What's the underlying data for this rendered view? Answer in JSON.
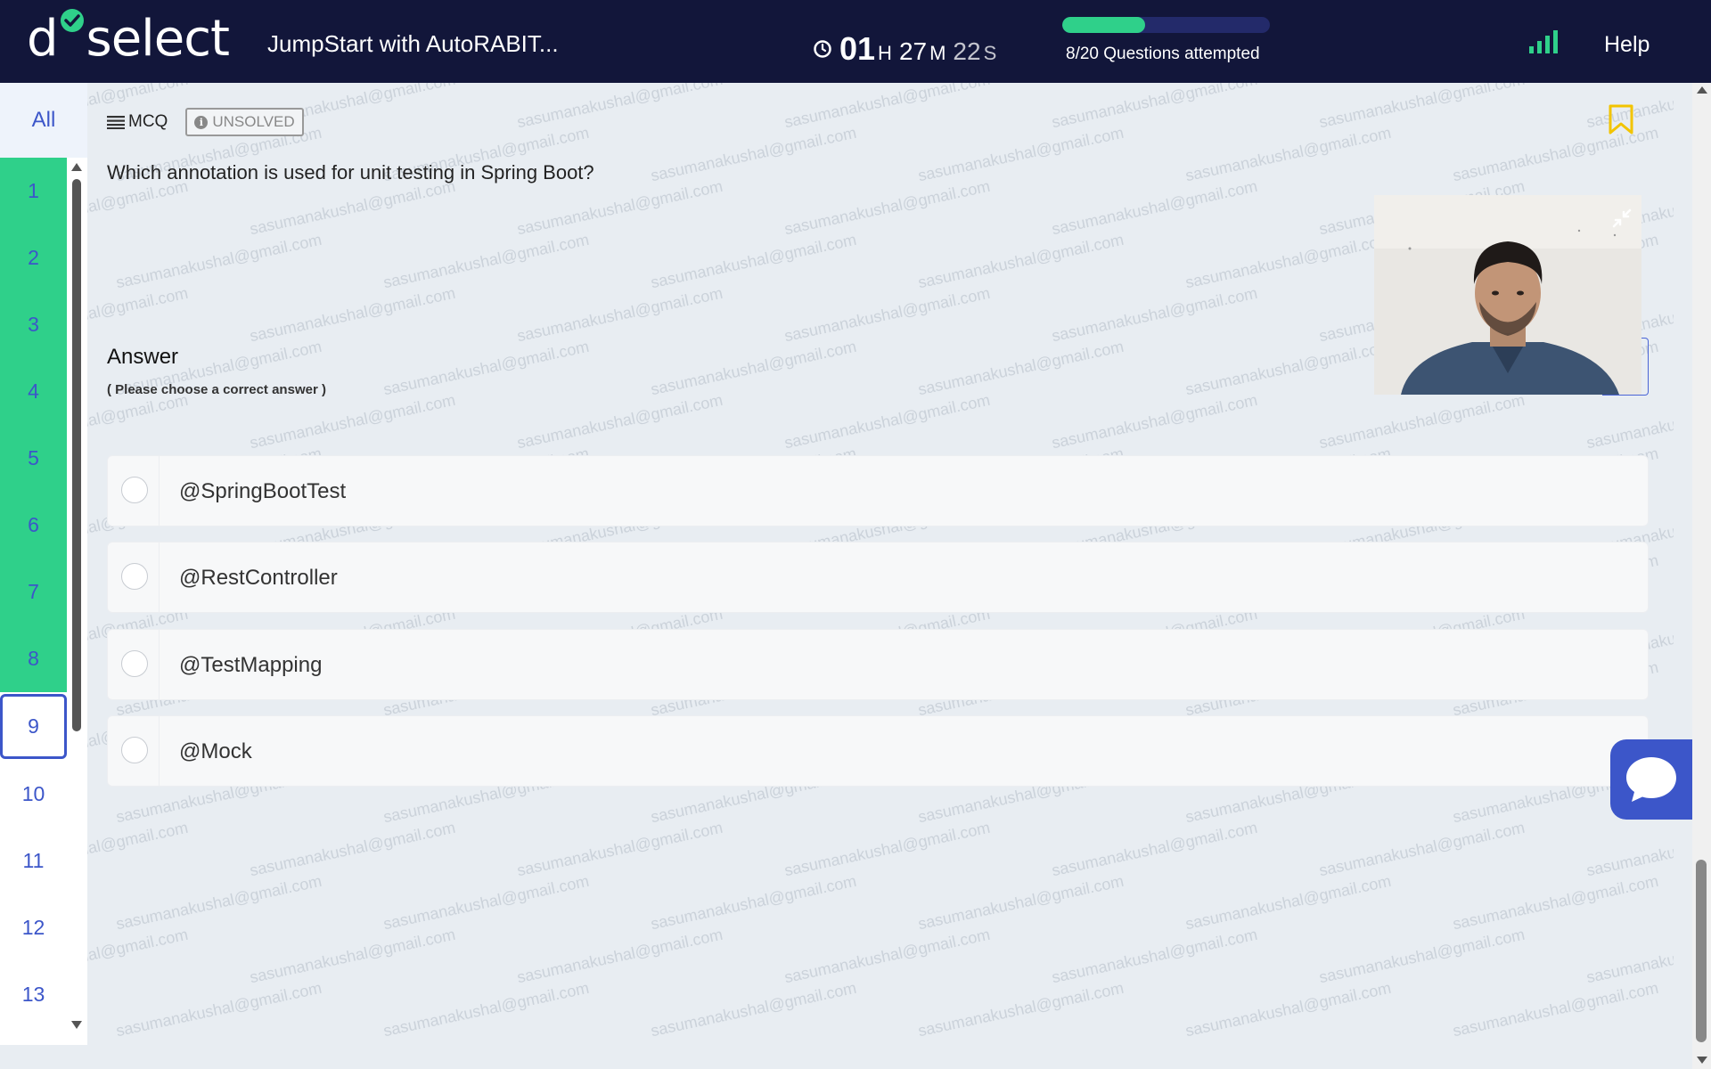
{
  "header": {
    "logo_left": "d",
    "logo_right": "select",
    "test_title": "JumpStart with AutoRABIT...",
    "timer": {
      "hours": "01",
      "hours_unit": "H",
      "minutes": "27",
      "minutes_unit": "M",
      "seconds": "22",
      "seconds_unit": "S"
    },
    "progress": {
      "attempted": 8,
      "total": 20,
      "text": "8/20 Questions attempted"
    },
    "help_label": "Help"
  },
  "sidebar": {
    "all_label": "All",
    "questions": [
      {
        "num": "1",
        "state": "answered"
      },
      {
        "num": "2",
        "state": "answered"
      },
      {
        "num": "3",
        "state": "answered"
      },
      {
        "num": "4",
        "state": "answered"
      },
      {
        "num": "5",
        "state": "answered"
      },
      {
        "num": "6",
        "state": "answered"
      },
      {
        "num": "7",
        "state": "answered"
      },
      {
        "num": "8",
        "state": "answered"
      },
      {
        "num": "9",
        "state": "current"
      },
      {
        "num": "10",
        "state": "unanswered"
      },
      {
        "num": "11",
        "state": "unanswered"
      },
      {
        "num": "12",
        "state": "unanswered"
      },
      {
        "num": "13",
        "state": "unanswered"
      }
    ]
  },
  "question": {
    "type_label": "MCQ",
    "status": "UNSOLVED",
    "text": "Which annotation is used for unit testing in Spring Boot?",
    "answer_heading": "Answer",
    "answer_hint": "( Please choose a correct answer )",
    "options": [
      "@SpringBootTest",
      "@RestController",
      "@TestMapping",
      "@Mock"
    ]
  },
  "watermark_text": "sasumanakushal@gmail.com",
  "colors": {
    "accent": "#3c56c9",
    "success": "#2fd08a",
    "header_bg": "#12163a",
    "bookmark": "#f2c400"
  }
}
